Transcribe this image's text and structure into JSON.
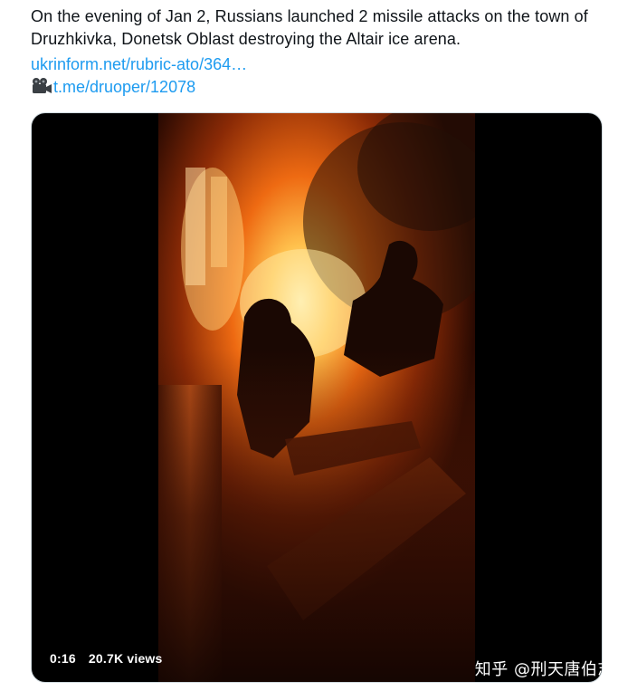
{
  "tweet": {
    "text": "On the evening of Jan 2, Russians launched 2 missile attacks on the town of Druzhkivka, Donetsk Oblast destroying the Altair ice arena.",
    "link_article": "ukrinform.net/rubric-ato/364…",
    "link_telegram": "t.me/druoper/12078"
  },
  "video": {
    "duration": "0:16",
    "views": "20.7K views"
  },
  "watermark": "知乎 @刑天唐伯志",
  "icons": {
    "camera": "movie-camera-icon"
  },
  "colors": {
    "text": "#0f1419",
    "link": "#1d9bf0",
    "media_bg": "#000000"
  }
}
